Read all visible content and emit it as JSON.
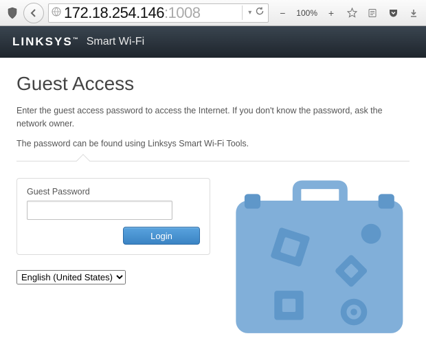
{
  "browser": {
    "url_main": "172.18.254.146",
    "url_suffix": ":1008",
    "zoom": "100%"
  },
  "header": {
    "brand": "LINKSYS",
    "tm": "™",
    "subbrand": "Smart Wi-Fi"
  },
  "page": {
    "title": "Guest Access",
    "desc1": "Enter the guest access password to access the Internet. If you don't know the password, ask the network owner.",
    "desc2": "The password can be found using Linksys Smart Wi-Fi Tools."
  },
  "login": {
    "label": "Guest Password",
    "value": "",
    "button": "Login"
  },
  "language": {
    "selected": "English (United States)"
  }
}
